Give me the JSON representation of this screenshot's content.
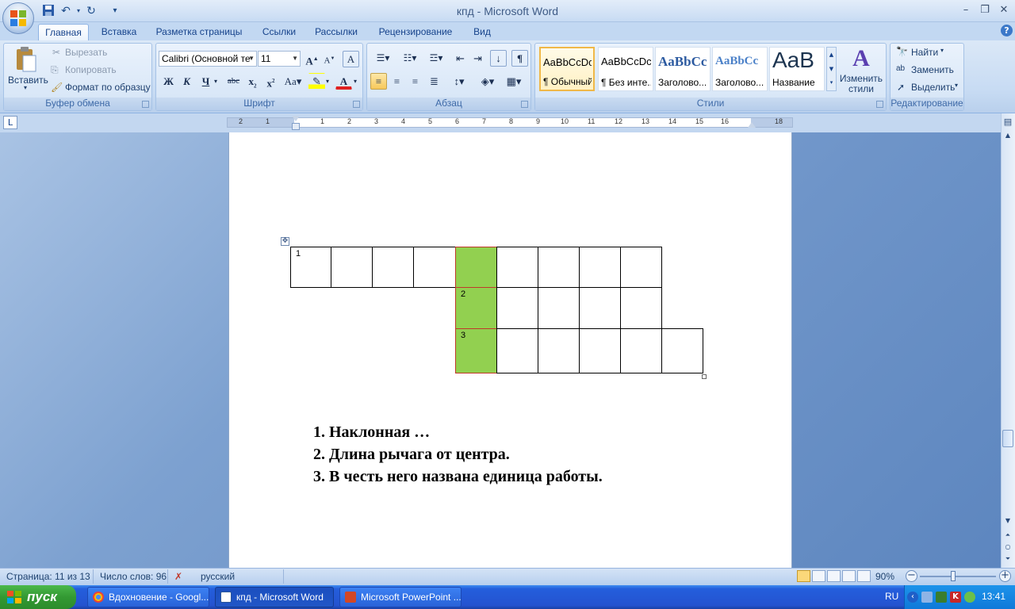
{
  "window": {
    "title": "кпд - Microsoft Word"
  },
  "qat": {
    "save_icon": "save-icon",
    "undo_icon": "undo-icon",
    "redo_icon": "redo-icon"
  },
  "tabs": [
    "Главная",
    "Вставка",
    "Разметка страницы",
    "Ссылки",
    "Рассылки",
    "Рецензирование",
    "Вид"
  ],
  "ribbon": {
    "clipboard": {
      "label": "Буфер обмена",
      "paste": "Вставить",
      "cut": "Вырезать",
      "copy": "Копировать",
      "format_painter": "Формат по образцу"
    },
    "font": {
      "label": "Шрифт",
      "font_name": "Calibri (Основной те",
      "font_size": "11"
    },
    "paragraph": {
      "label": "Абзац"
    },
    "styles": {
      "label": "Стили",
      "items": [
        {
          "sample": "AaBbCcDc",
          "name": "¶ Обычный"
        },
        {
          "sample": "AaBbCcDc",
          "name": "¶ Без инте..."
        },
        {
          "sample": "AaBbCc",
          "name": "Заголово..."
        },
        {
          "sample": "AaBbCc",
          "name": "Заголово..."
        },
        {
          "sample": "AaB",
          "name": "Название"
        }
      ],
      "change_styles": "Изменить стили"
    },
    "editing": {
      "label": "Редактирование",
      "find": "Найти",
      "replace": "Заменить",
      "select": "Выделить"
    }
  },
  "ruler": {
    "numbers": [
      "2",
      "1",
      "1",
      "2",
      "3",
      "4",
      "5",
      "6",
      "7",
      "8",
      "9",
      "10",
      "11",
      "12",
      "13",
      "14",
      "15",
      "16",
      "18"
    ]
  },
  "document": {
    "crossword": {
      "numbers": [
        "1",
        "2",
        "3"
      ],
      "highlight_color": "#92d050"
    },
    "clues": [
      "1. Наклонная …",
      "2. Длина рычага от центра.",
      "3. В честь него названа единица работы."
    ]
  },
  "statusbar": {
    "page": "Страница: 11 из 13",
    "words": "Число слов: 96",
    "language": "русский",
    "zoom": "90%"
  },
  "taskbar": {
    "start": "пуск",
    "tasks": [
      "Вдохновение - Googl...",
      "кпд - Microsoft Word",
      "Microsoft PowerPoint ..."
    ],
    "lang": "RU",
    "clock": "13:41"
  }
}
